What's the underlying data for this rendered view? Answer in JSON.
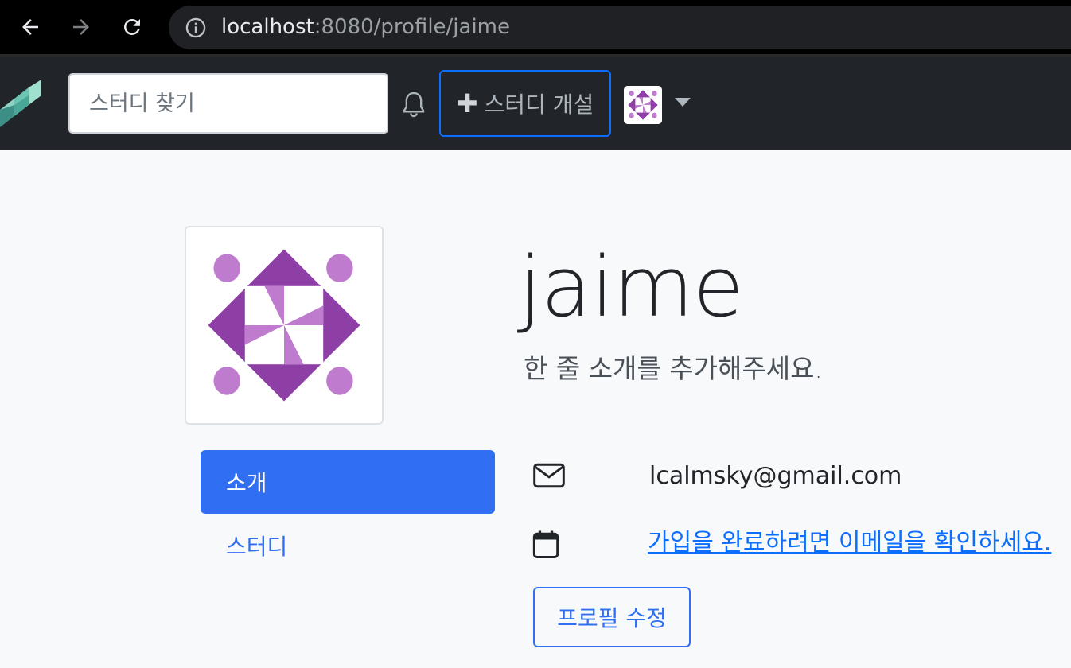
{
  "browser": {
    "url_host": "localhost",
    "url_path": ":8080/profile/jaime",
    "icons": {
      "back": "arrow-left-icon",
      "forward": "arrow-right-icon",
      "reload": "reload-icon",
      "info": "info-icon"
    }
  },
  "navbar": {
    "search_placeholder": "스터디 찾기",
    "create_label": "스터디 개설",
    "create_icon": "plus-icon",
    "notification_icon": "bell-icon",
    "dropdown_icon": "caret-down-icon"
  },
  "profile": {
    "username": "jaime",
    "bio": "한 줄 소개를 추가해주세요.",
    "email": "lcalmsky@gmail.com",
    "verify_message": "가입을 완료하려면 이메일을 확인하세요.",
    "edit_label": "프로필 수정"
  },
  "tabs": [
    {
      "label": "소개",
      "active": true
    },
    {
      "label": "스터디",
      "active": false
    }
  ],
  "colors": {
    "primary": "#316ff2",
    "navbar_bg": "#212529",
    "identicon_dark": "#8e3fa5",
    "identicon_light": "#bf7ccf"
  }
}
